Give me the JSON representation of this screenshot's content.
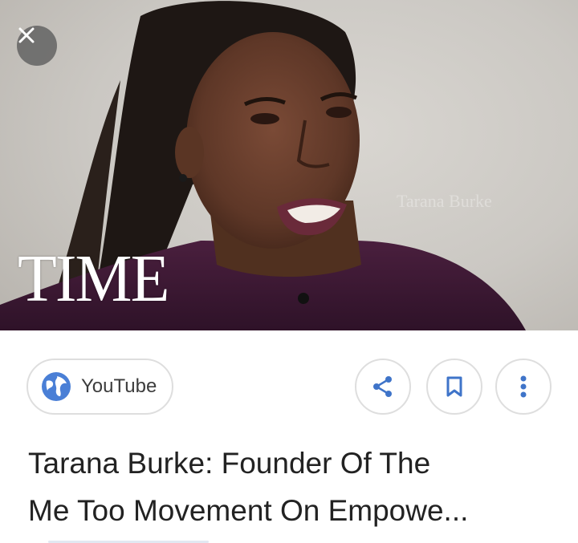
{
  "thumbnail": {
    "logo_text": "TIME",
    "watermark_text": "Tarana Burke"
  },
  "source": {
    "label": "YouTube",
    "icon": "globe-icon"
  },
  "actions": [
    {
      "icon": "share-icon"
    },
    {
      "icon": "bookmark-icon"
    },
    {
      "icon": "more-vert-icon"
    }
  ],
  "result": {
    "title_line1": "Tarana Burke: Founder Of The",
    "title_line2": "Me Too Movement On Empowe..."
  },
  "colors": {
    "accent_blue": "#4a7fd6",
    "icon_blue": "#3f74c9",
    "border": "#dedede",
    "title_text": "#222222"
  }
}
